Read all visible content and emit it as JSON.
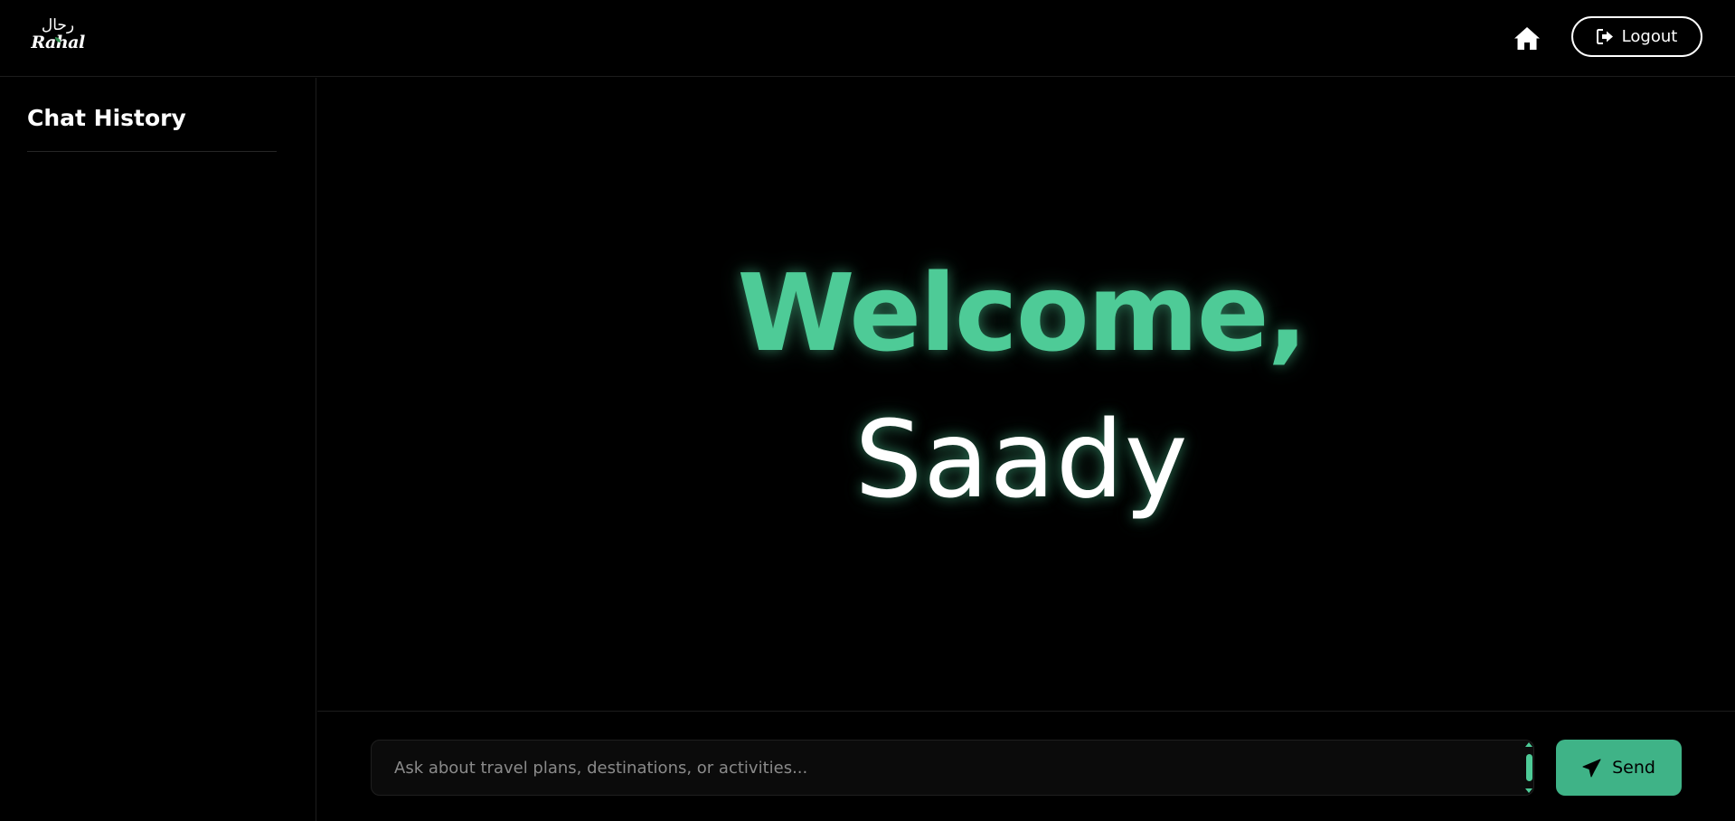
{
  "header": {
    "logo": {
      "arabic_text": "رحال",
      "latin_text": "Rahal"
    },
    "home_icon": "home-icon",
    "logout_label": "Logout",
    "logout_icon": "sign-out-icon"
  },
  "sidebar": {
    "title": "Chat History",
    "items": []
  },
  "main": {
    "welcome_text": "Welcome,",
    "username": "Saady"
  },
  "composer": {
    "placeholder": "Ask about travel plans, destinations, or activities...",
    "value": "",
    "send_label": "Send",
    "send_icon": "paper-plane-icon"
  },
  "colors": {
    "accent": "#4ecb97",
    "button": "#3fb387",
    "background": "#000000"
  }
}
